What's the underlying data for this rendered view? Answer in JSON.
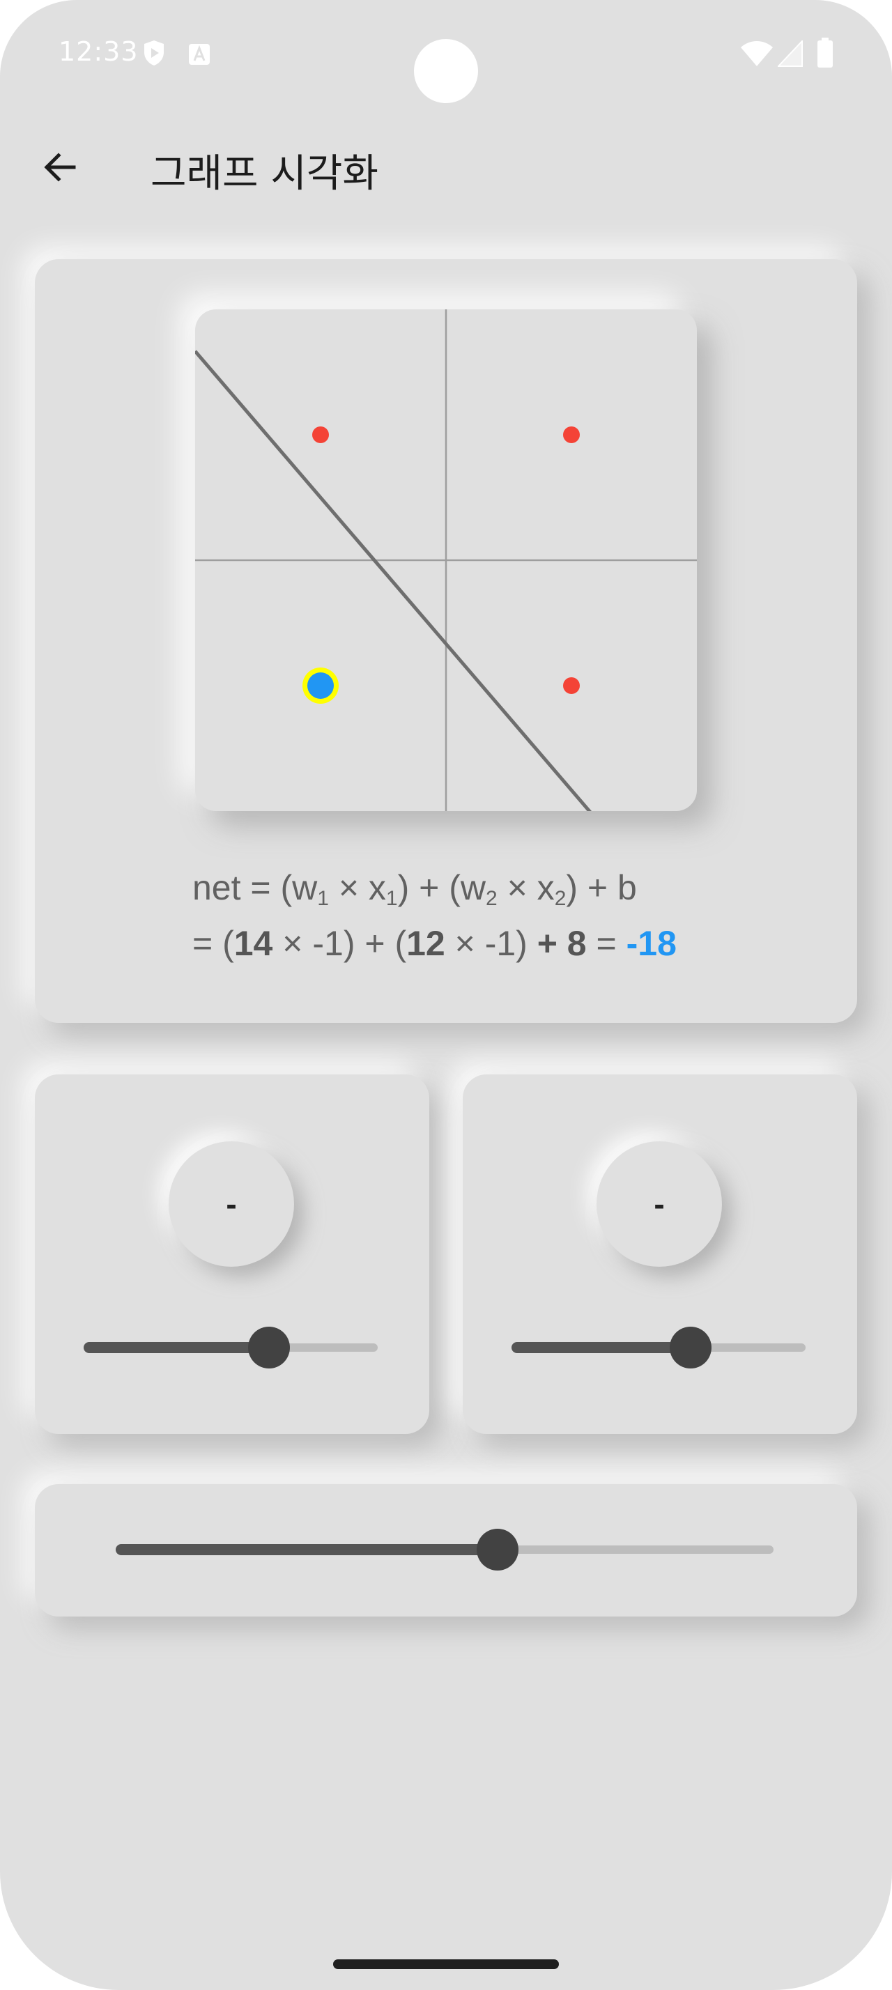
{
  "status_bar": {
    "time": "12:33",
    "icons": [
      "shield-play-icon",
      "font-a-icon",
      "wifi-icon",
      "signal-icon",
      "battery-icon"
    ]
  },
  "app_bar": {
    "back_icon": "arrow-left-icon",
    "title": "그래프 시각화"
  },
  "graph": {
    "range": {
      "x": [
        -2,
        2
      ],
      "y": [
        -2,
        2
      ]
    },
    "axis_color": "#9e9e9e",
    "line_color": "#6e6e6e",
    "points": [
      {
        "x": -1,
        "y": 1,
        "color": "#f44336",
        "highlighted": false
      },
      {
        "x": 1,
        "y": 1,
        "color": "#f44336",
        "highlighted": false
      },
      {
        "x": -1,
        "y": -1,
        "color": "#2196f3",
        "highlighted": true,
        "ring_color": "#ffff00"
      },
      {
        "x": 1,
        "y": -1,
        "color": "#f44336",
        "highlighted": false
      }
    ],
    "decision_line": {
      "w1": 14,
      "w2": 12,
      "b": 8
    }
  },
  "formula": {
    "line1": {
      "prefix": "net = (w",
      "sub_w1": "1",
      "times1": " × x",
      "sub_x1": "1",
      "mid": ") + (w",
      "sub_w2": "2",
      "times2": " × x",
      "sub_x2": "2",
      "suffix": ") + b"
    },
    "line2": {
      "eq_open": "= (",
      "w1": "14",
      "x1_part": " × -1) + (",
      "w2": "12",
      "x2_part": " × -1) ",
      "b_part": "+ 8",
      "eq": " = ",
      "result": "-18"
    }
  },
  "inputs": [
    {
      "knob_label": "-",
      "slider_fraction": 0.63
    },
    {
      "knob_label": "-",
      "slider_fraction": 0.61
    }
  ],
  "bias_slider": {
    "fraction": 0.58
  },
  "colors": {
    "background": "#e0e0e0",
    "accent": "#2196f3",
    "negative_point": "#f44336",
    "highlight_ring": "#ffff00",
    "slider_active": "#555555",
    "slider_thumb": "#424242",
    "slider_inactive": "#bdbdbd"
  }
}
